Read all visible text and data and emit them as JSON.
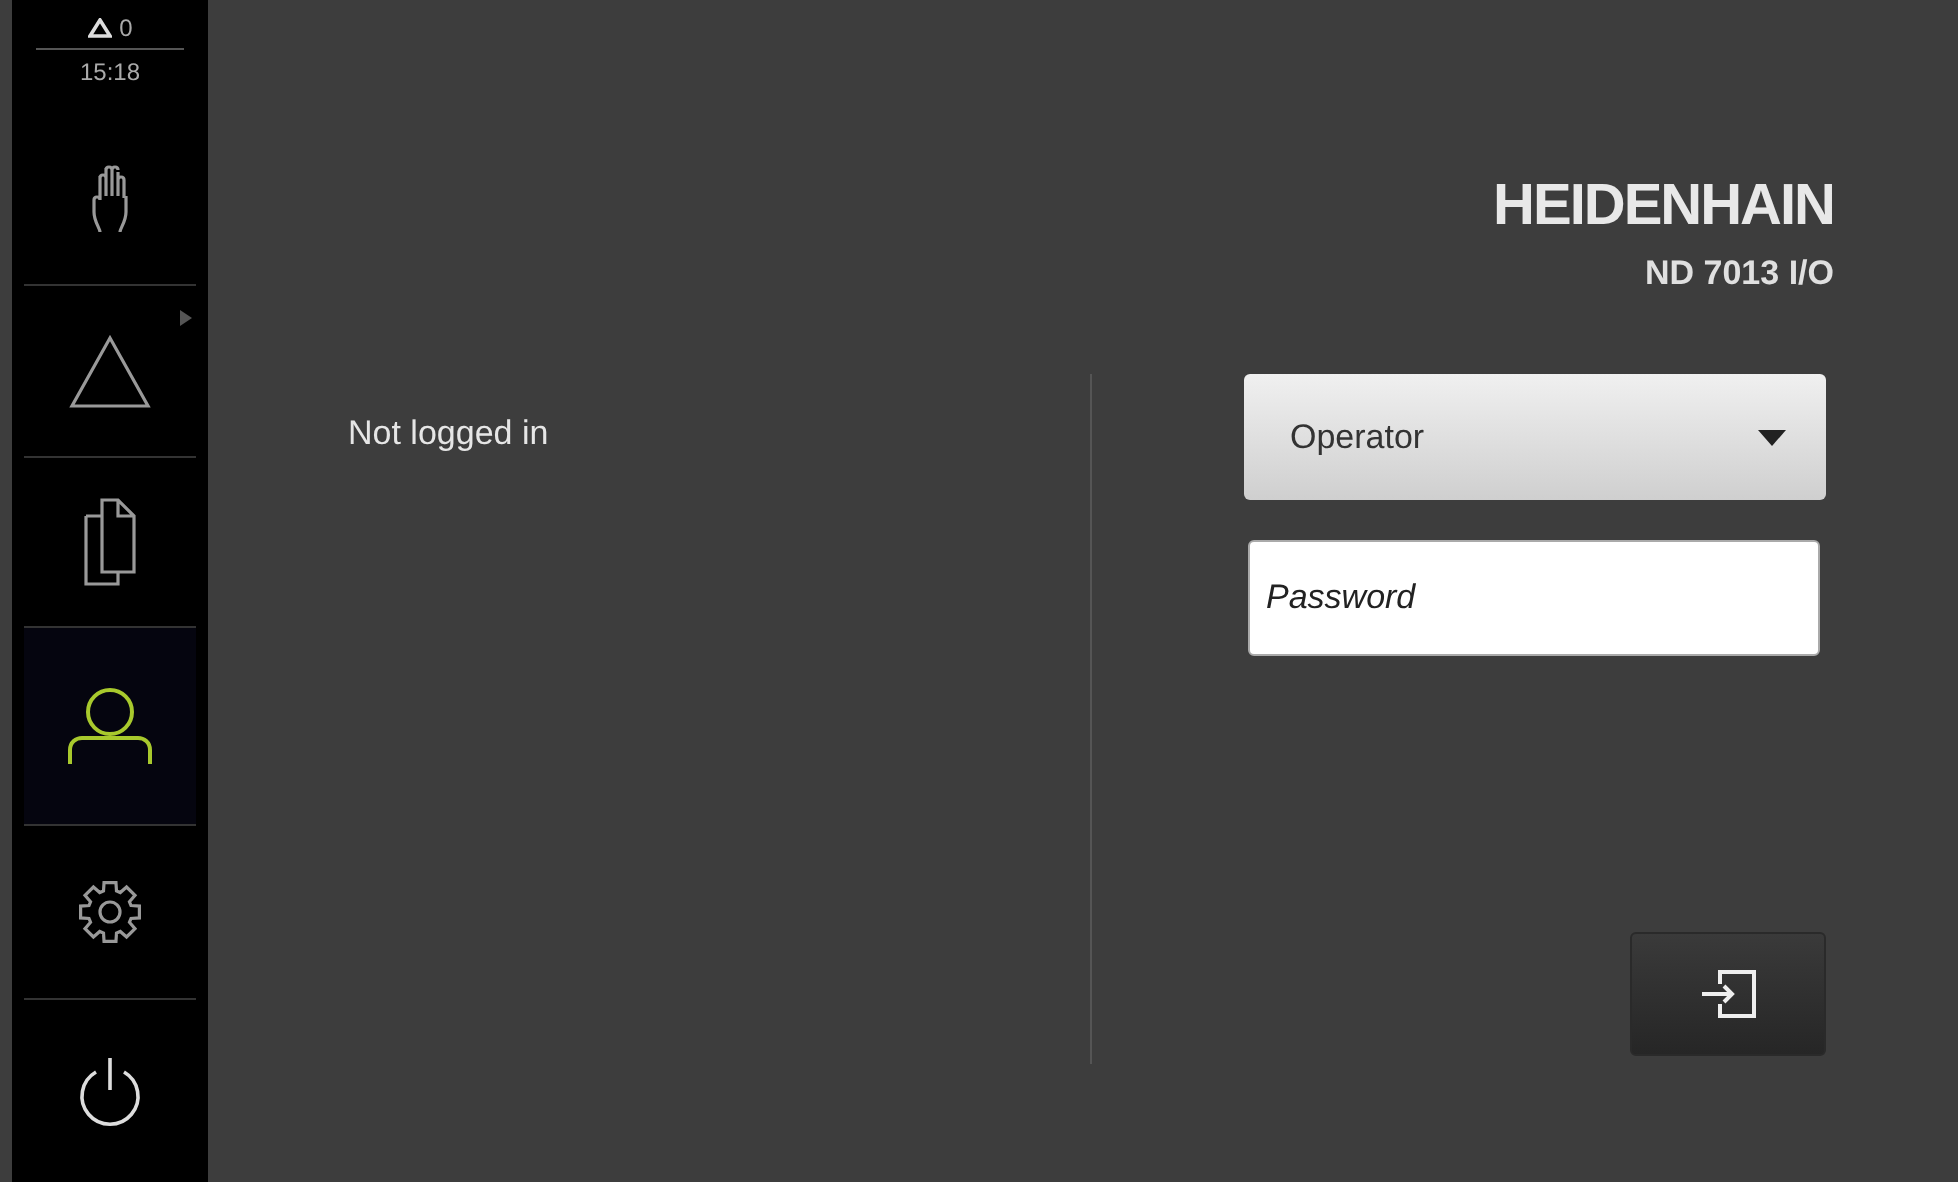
{
  "status": {
    "warnings": "0",
    "time": "15:18"
  },
  "sidebar": {
    "items": [
      {
        "selected": false
      },
      {
        "selected": false
      },
      {
        "selected": false
      },
      {
        "selected": true
      },
      {
        "selected": false
      },
      {
        "selected": false
      }
    ]
  },
  "brand": {
    "logo": "HEIDENHAIN",
    "model": "ND 7013 I/O"
  },
  "login_status": "Not logged in",
  "user_select": {
    "value": "Operator"
  },
  "password": {
    "placeholder": "Password"
  }
}
